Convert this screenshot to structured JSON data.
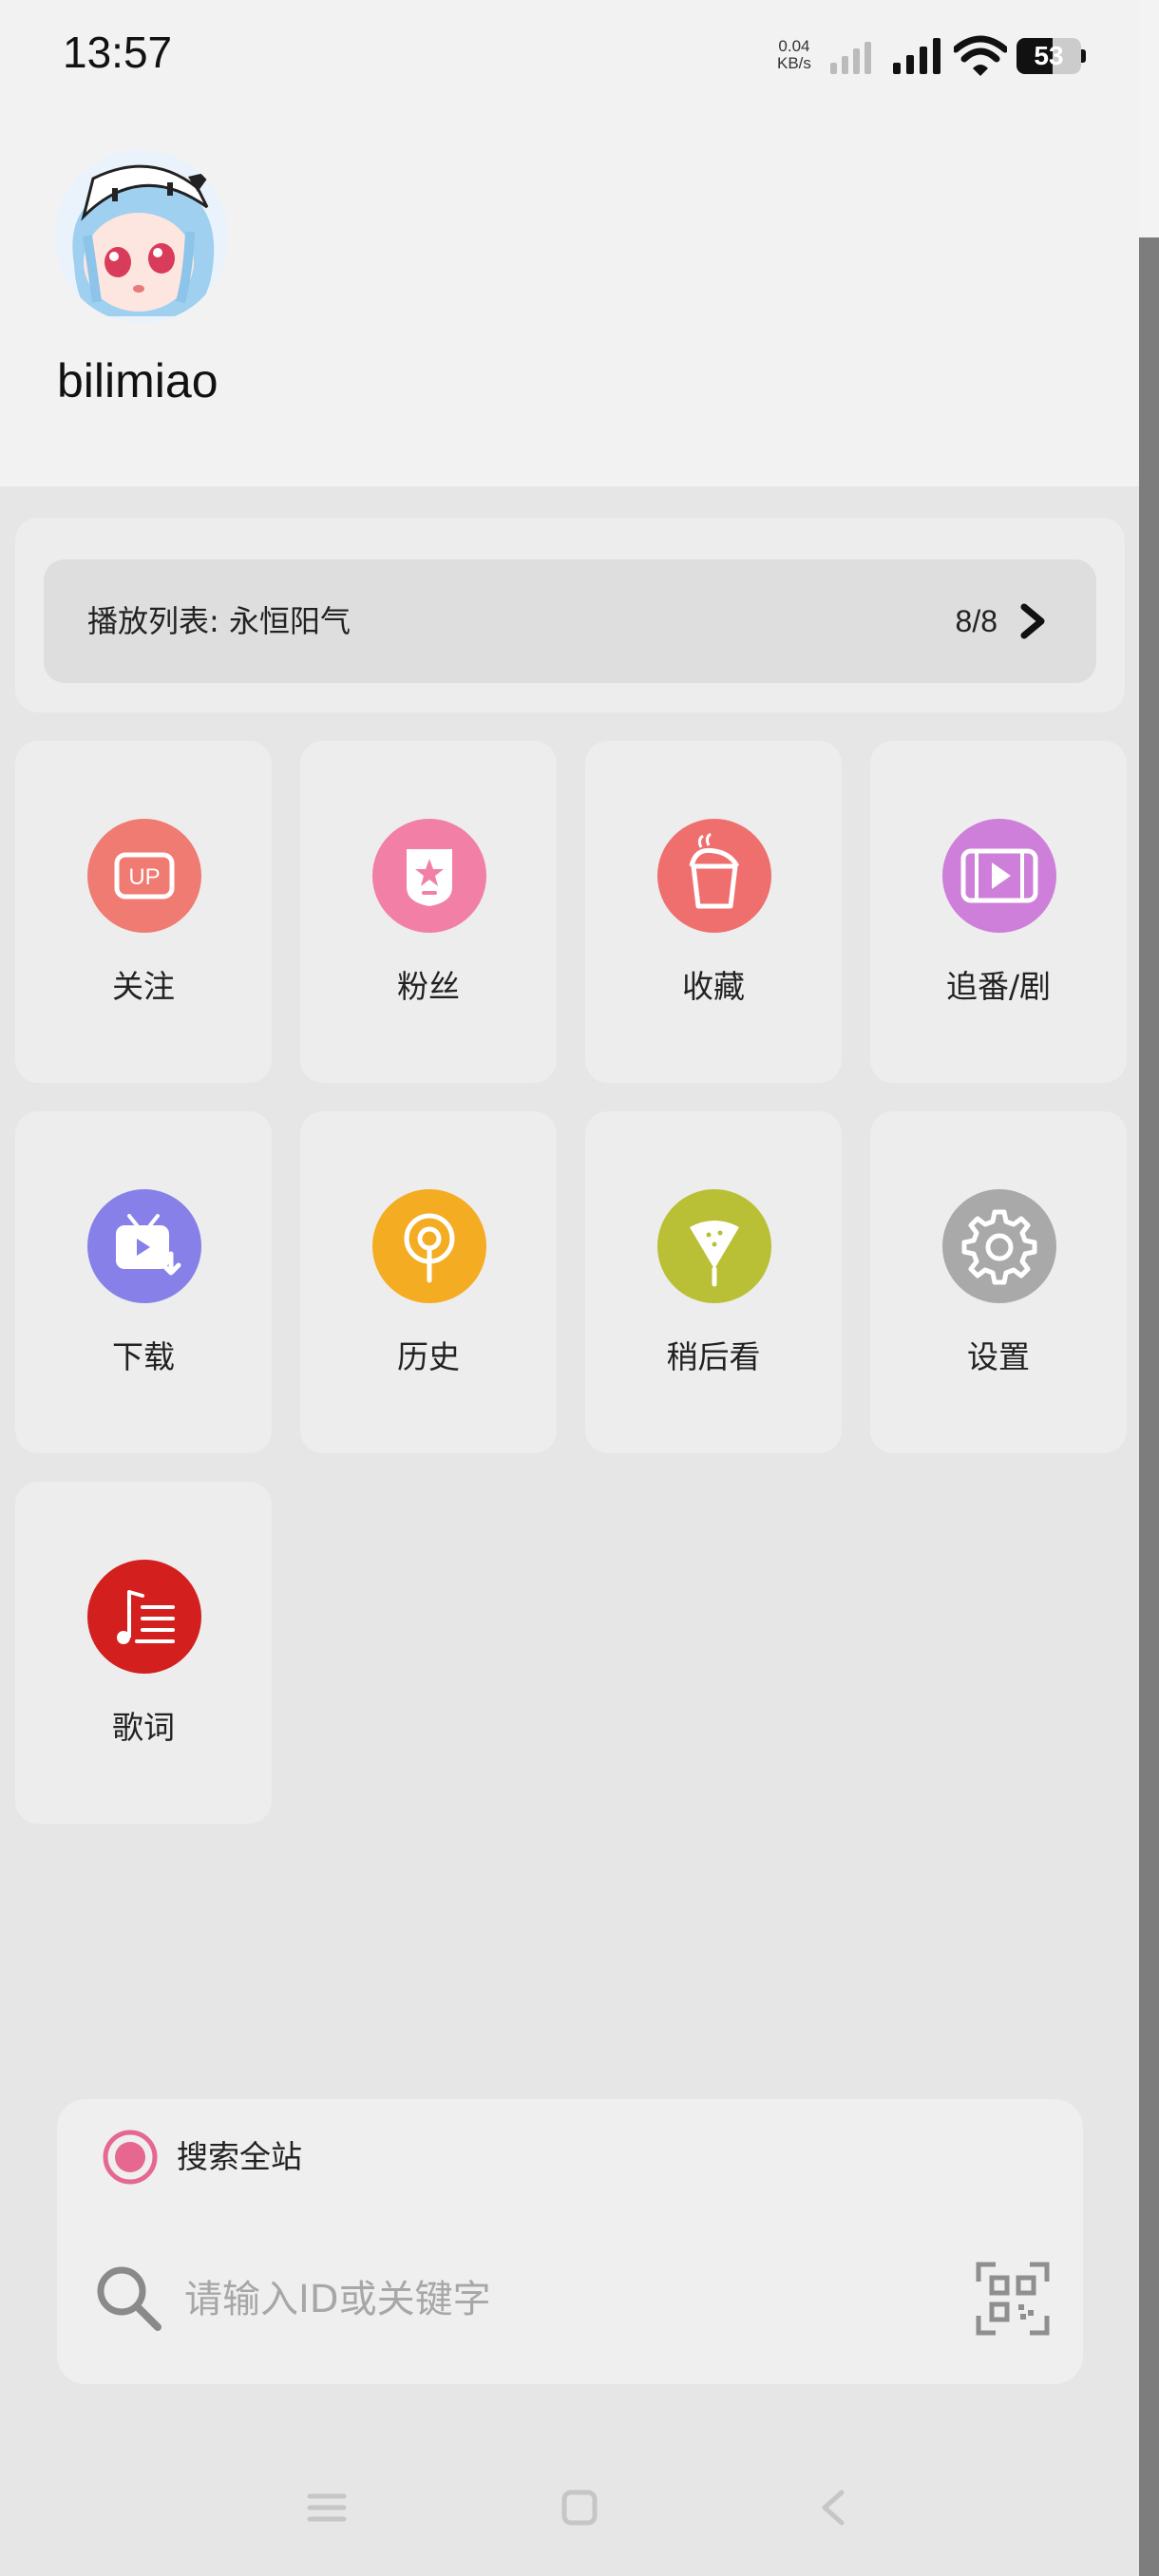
{
  "statusbar": {
    "time": "13:57",
    "net_speed_value": "0.04",
    "net_speed_unit": "KB/s",
    "battery": "53"
  },
  "profile": {
    "username": "bilimiao"
  },
  "playlist": {
    "label": "播放列表: 永恒阳气",
    "count": "8/8"
  },
  "menu": {
    "items": [
      {
        "label": "关注",
        "icon": "up-icon",
        "color": "#ef7b72"
      },
      {
        "label": "粉丝",
        "icon": "fan-badge-icon",
        "color": "#f17fa6"
      },
      {
        "label": "收藏",
        "icon": "bucket-icon",
        "color": "#ef6f6f"
      },
      {
        "label": "追番/剧",
        "icon": "film-play-icon",
        "color": "#cd7fd9"
      },
      {
        "label": "下载",
        "icon": "tv-download-icon",
        "color": "#8680e8"
      },
      {
        "label": "历史",
        "icon": "history-icon",
        "color": "#f4ac23"
      },
      {
        "label": "稍后看",
        "icon": "watermelon-icon",
        "color": "#b9c036"
      },
      {
        "label": "设置",
        "icon": "gear-icon",
        "color": "#a9a9a9"
      },
      {
        "label": "歌词",
        "icon": "lyrics-icon",
        "color": "#d3201f"
      }
    ]
  },
  "search": {
    "scope_label": "搜索全站",
    "placeholder": "请输入ID或关键字",
    "accent": "#e6678f"
  }
}
